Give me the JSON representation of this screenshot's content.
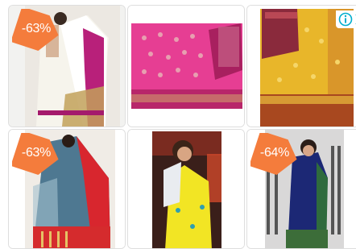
{
  "products": [
    {
      "discount": "-63%",
      "has_badge": true
    },
    {
      "discount": "",
      "has_badge": false
    },
    {
      "discount": "",
      "has_badge": false
    },
    {
      "discount": "-63%",
      "has_badge": true
    },
    {
      "discount": "",
      "has_badge": false
    },
    {
      "discount": "-64%",
      "has_badge": true
    }
  ],
  "adchoices": {
    "info_icon": "info-icon",
    "close_icon": "chevron-right-icon"
  },
  "colors": {
    "badge": "#f47c3c",
    "border": "#dedede",
    "adchoices": "#00aecd"
  }
}
